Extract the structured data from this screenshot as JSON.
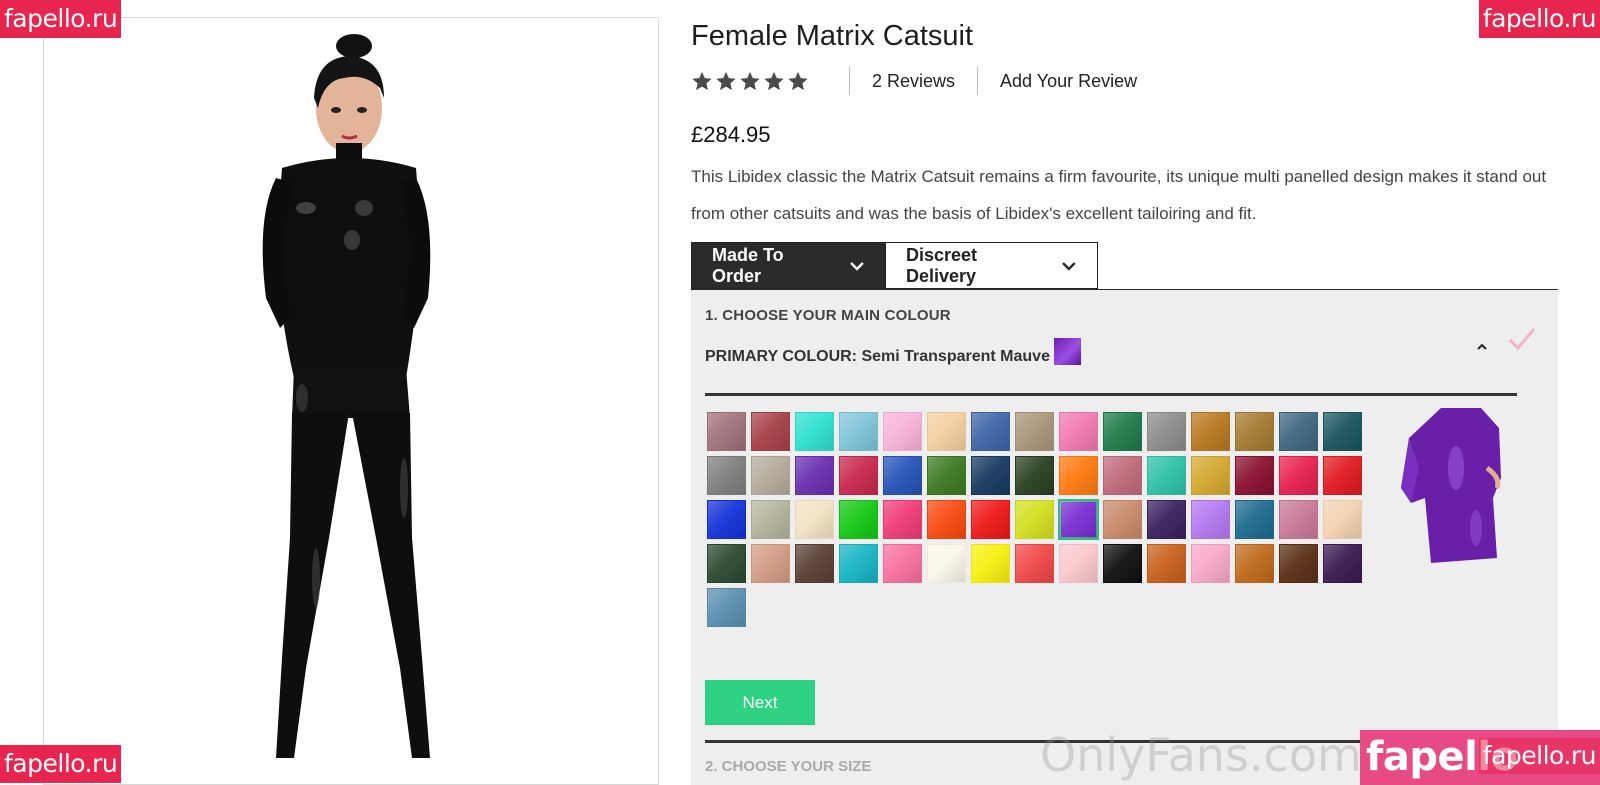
{
  "watermarks": {
    "top_left": "fapello.ru",
    "top_right": "fapello.ru",
    "bottom_left": "fapello.ru",
    "bottom_right_large": "fapello",
    "bottom_right_small": "fapello.ru",
    "onlyfans": "OnlyFans.com/"
  },
  "product": {
    "title": "Female Matrix Catsuit",
    "rating_stars": 5,
    "reviews_label": "2  Reviews",
    "add_review_label": "Add Your Review",
    "price": "£284.95",
    "description": "This Libidex classic the Matrix Catsuit remains a firm favourite, its unique multi panelled design makes it stand out from other catsuits and was the basis of Libidex's excellent tailoiring and fit."
  },
  "tabs": [
    {
      "label": "Made To Order",
      "active": true
    },
    {
      "label": "Discreet Delivery",
      "active": false
    }
  ],
  "step1": {
    "title": "1. CHOOSE YOUR MAIN COLOUR",
    "primary_label": "PRIMARY COLOUR: Semi Transparent Mauve",
    "selected_color": "#7a2ed0",
    "check_color": "#f4b3c3"
  },
  "swatches": [
    "#a0727a",
    "#a84048",
    "#2fe0d2",
    "#7fc4d8",
    "#f7b3d8",
    "#f5cfa0",
    "#3e64a8",
    "#a8967a",
    "#f07ab0",
    "#1f7a4a",
    "#8c8c8c",
    "#b97820",
    "#a47a30",
    "#3f6680",
    "#1a5560",
    "#7f7f7f",
    "#b5ab9c",
    "#6a2fb0",
    "#c8284e",
    "#2553b8",
    "#3d7a22",
    "#173a60",
    "#2a4020",
    "#ff7a10",
    "#c06a7a",
    "#2ec2a8",
    "#d4a830",
    "#8a1030",
    "#e82050",
    "#e01a20",
    "#1432d8",
    "#b4b49c",
    "#f3e3c4",
    "#14c814",
    "#f03c78",
    "#f84a10",
    "#f01818",
    "#d2e020",
    "#7a2ed0",
    "#c88a6a",
    "#3a2060",
    "#b478f0",
    "#1e6a90",
    "#c87898",
    "#f4d2b0",
    "#2c4a30",
    "#d49c84",
    "#5a4036",
    "#18b4c4",
    "#f870a0",
    "#faf6ea",
    "#f8f010",
    "#f04848",
    "#fac8cc",
    "#101010",
    "#c8601c",
    "#f8a8c8",
    "#c06a1c",
    "#5a3014",
    "#3a1a50",
    "#5a90b0"
  ],
  "selected_swatch_index": 38,
  "buttons": {
    "next": "Next"
  },
  "step2": {
    "title": "2. CHOOSE YOUR SIZE"
  },
  "colors": {
    "accent_green": "#2fd183",
    "dark": "#2b2b2b",
    "panel_bg": "#eeeeee"
  }
}
